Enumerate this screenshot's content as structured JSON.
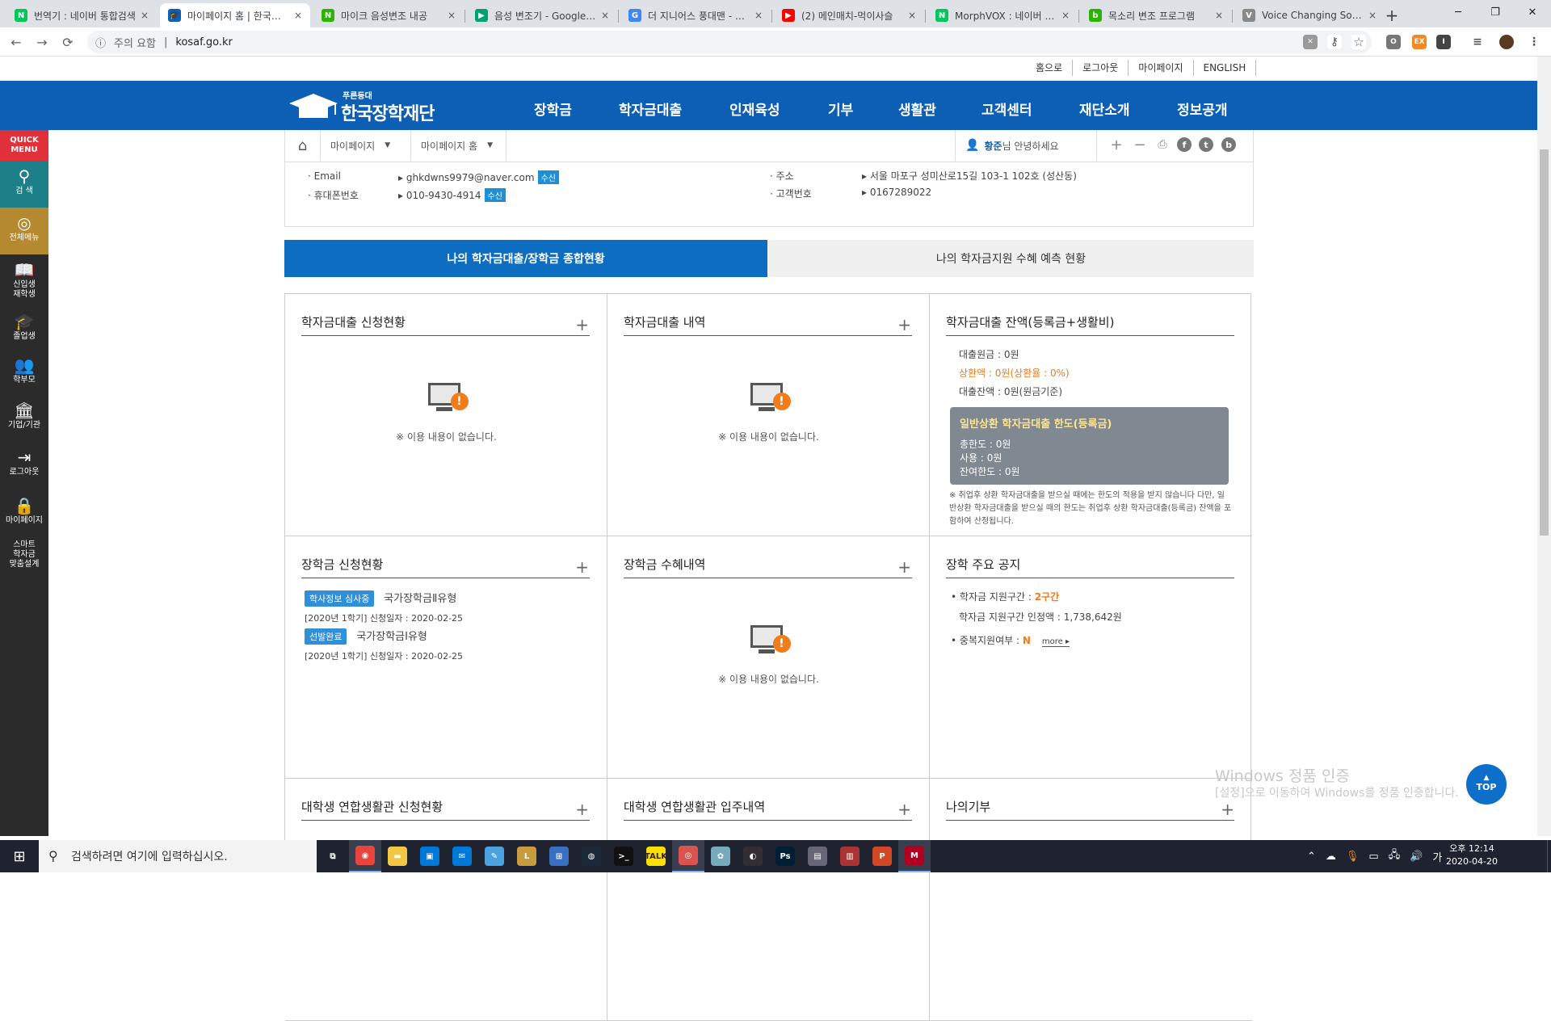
{
  "browser": {
    "tabs": [
      {
        "title": "번역기 : 네이버 통합검색",
        "favicon_color": "#03c75a",
        "favicon_letter": "N",
        "active": false
      },
      {
        "title": "마이페이지 홈 | 한국장학재단",
        "favicon_color": "#0c5fb5",
        "favicon_letter": "🎓",
        "active": true
      },
      {
        "title": "마이크 음성변조 내공",
        "favicon_color": "#2db400",
        "favicon_letter": "N",
        "active": false
      },
      {
        "title": "음성 변조기 - Google Play",
        "favicon_color": "#00a173",
        "favicon_letter": "▶",
        "active": false
      },
      {
        "title": "더 지니어스 풍대맨 - Google",
        "favicon_color": "#4285f4",
        "favicon_letter": "G",
        "active": false
      },
      {
        "title": "(2) 메인매치-먹이사슬",
        "favicon_color": "#ff0000",
        "favicon_letter": "▶",
        "active": false
      },
      {
        "title": "MorphVOX : 네이버 통합검색",
        "favicon_color": "#03c75a",
        "favicon_letter": "N",
        "active": false
      },
      {
        "title": "목소리 변조 프로그램",
        "favicon_color": "#2db400",
        "favicon_letter": "b",
        "active": false
      },
      {
        "title": "Voice Changing Software",
        "favicon_color": "#888888",
        "favicon_letter": "V",
        "active": false
      }
    ],
    "close_glyph": "×",
    "new_tab_glyph": "+",
    "window_controls": {
      "minimize": "─",
      "maximize": "❐",
      "close": "✕"
    },
    "security_warning": "주의 요함",
    "url": "kosaf.go.kr",
    "nav": {
      "back": "←",
      "forward": "→",
      "reload": "⟳",
      "info": "ⓘ"
    }
  },
  "site": {
    "util_links": [
      "홈으로",
      "로그아웃",
      "마이페이지",
      "ENGLISH"
    ],
    "logo": {
      "small": "푸른등대",
      "big": "한국장학재단"
    },
    "gnb": [
      "장학금",
      "학자금대출",
      "인재육성",
      "기부",
      "생활관",
      "고객센터",
      "재단소개",
      "정보공개"
    ],
    "location": {
      "home_icon": "⌂",
      "level1": "마이페이지",
      "level2": "마이페이지 홈",
      "greeting_name": "황준",
      "greeting_suffix": "님 안녕하세요"
    },
    "tools": {
      "zoom_in": "+",
      "zoom_out": "−",
      "print": "⎙",
      "facebook": "f",
      "twitter": "t",
      "blog": "b"
    },
    "quick_menu": {
      "title_line1": "QUICK",
      "title_line2": "MENU",
      "items": [
        {
          "label": "검 색",
          "icon": "⚲"
        },
        {
          "label": "전체메뉴",
          "icon": "◎"
        },
        {
          "label": "신입생\n재학생",
          "icon": "📖"
        },
        {
          "label": "졸업생",
          "icon": "🎓"
        },
        {
          "label": "학부모",
          "icon": "👥"
        },
        {
          "label": "기업/기관",
          "icon": "🏛"
        },
        {
          "label": "로그아웃",
          "icon": "⇥"
        },
        {
          "label": "마이페이지",
          "icon": "🔒"
        },
        {
          "label": "스마트\n학자금\n맞춤설계",
          "icon": ""
        }
      ]
    },
    "profile": {
      "email_label": "Email",
      "email_value": "ghkdwns9979@naver.com",
      "email_badge": "수신",
      "phone_label": "휴대폰번호",
      "phone_value": "010-9430-4914",
      "phone_badge": "수신",
      "address_label": "주소",
      "address_value": "서울 마포구 성미산로15길 103-1 102호 (성산동)",
      "customer_label": "고객번호",
      "customer_value": "0167289022"
    },
    "big_tabs": [
      "나의 학자금대출/장학금 종합현황",
      "나의 학자금지원 수혜 예측 현황"
    ],
    "empty_text": "※ 이용 내용이 없습니다.",
    "more_plus": "+",
    "boxes": {
      "loan_apply": {
        "title": "학자금대출 신청현황"
      },
      "loan_history": {
        "title": "학자금대출 내역"
      },
      "loan_balance": {
        "title": "학자금대출 잔액(등록금+생활비)",
        "principal": "대출원금 : 0원",
        "repaid": "상환액 : 0원(상환율 : 0%)",
        "balance": "대출잔액 : 0원(원금기준)",
        "limit_title": "일반상환 학자금대출 한도(등록금)",
        "limit_total": "총한도 : 0원",
        "limit_used": "사용 : 0원",
        "limit_left": "잔여한도 : 0원",
        "note": "※ 취업후 상환 학자금대출을 받으실 때에는 한도의 적용을 받지 않습니다 다만, 일반상환 학자금대출을 받으실 때의 한도는 취업후 상환 학자금대출(등록금) 잔액을 포함하여 산정됩니다."
      },
      "scholar_apply": {
        "title": "장학금 신청현황",
        "items": [
          {
            "tag": "학사정보 심사중",
            "tag_color": "#2f8fd8",
            "name": "국가장학금Ⅱ유형",
            "meta": "[2020년 1학기]  신청일자 : 2020-02-25"
          },
          {
            "tag": "선발완료",
            "tag_color": "#2f8fd8",
            "name": "국가장학금Ⅰ유형",
            "meta": "[2020년 1학기]  신청일자 : 2020-02-25"
          }
        ]
      },
      "scholar_received": {
        "title": "장학금 수혜내역"
      },
      "scholar_notice": {
        "title": "장학 주요 공지",
        "section_label": "학자금 지원구간 : ",
        "section_value": "2구간",
        "amount": "학자금 지원구간 인정액 : 1,738,642원",
        "dup_label": "중복지원여부 : ",
        "dup_value": "N",
        "more": "more ▸"
      },
      "dorm_apply": {
        "title": "대학생 연합생활관 신청현황"
      },
      "dorm_stay": {
        "title": "대학생 연합생활관 입주내역"
      },
      "donation": {
        "title": "나의기부"
      }
    },
    "top_button": "TOP"
  },
  "watermark": {
    "line1": "Windows 정품 인증",
    "line2": "[설정]으로 이동하여 Windows를 정품 인증합니다."
  },
  "taskbar": {
    "search_placeholder": "검색하려면 여기에 입력하십시오.",
    "clock_time": "오후 12:14",
    "clock_date": "2020-04-20",
    "apps": [
      {
        "name": "task-view",
        "color": "#1f2330",
        "glyph": "⧉",
        "running": false
      },
      {
        "name": "chrome",
        "color": "#e8453c",
        "glyph": "◉",
        "running": true
      },
      {
        "name": "file-explorer",
        "color": "#f2c744",
        "glyph": "▬",
        "running": false
      },
      {
        "name": "store",
        "color": "#0078d7",
        "glyph": "▣",
        "running": false
      },
      {
        "name": "mail",
        "color": "#0078d7",
        "glyph": "✉",
        "running": false
      },
      {
        "name": "notes",
        "color": "#4aa3df",
        "glyph": "✎",
        "running": false
      },
      {
        "name": "lol",
        "color": "#c89b3c",
        "glyph": "L",
        "running": false
      },
      {
        "name": "app-blue",
        "color": "#3b6fc2",
        "glyph": "⊞",
        "running": false
      },
      {
        "name": "steam",
        "color": "#1b2838",
        "glyph": "◍",
        "running": false
      },
      {
        "name": "terminal",
        "color": "#111111",
        "glyph": ">_",
        "running": false
      },
      {
        "name": "kakaotalk",
        "color": "#f9e000",
        "glyph": "TALK",
        "running": false
      },
      {
        "name": "camera-app",
        "color": "#d9534f",
        "glyph": "◎",
        "running": true
      },
      {
        "name": "paint-app",
        "color": "#7ab",
        "glyph": "✿",
        "running": false
      },
      {
        "name": "obs",
        "color": "#302e31",
        "glyph": "◐",
        "running": false
      },
      {
        "name": "photoshop",
        "color": "#001e36",
        "glyph": "Ps",
        "running": false
      },
      {
        "name": "app-window",
        "color": "#667",
        "glyph": "▤",
        "running": false
      },
      {
        "name": "app-doc",
        "color": "#aa3333",
        "glyph": "▥",
        "running": false
      },
      {
        "name": "powerpoint",
        "color": "#d24726",
        "glyph": "P",
        "running": false
      },
      {
        "name": "app-red",
        "color": "#b00020",
        "glyph": "M",
        "running": true
      }
    ]
  }
}
